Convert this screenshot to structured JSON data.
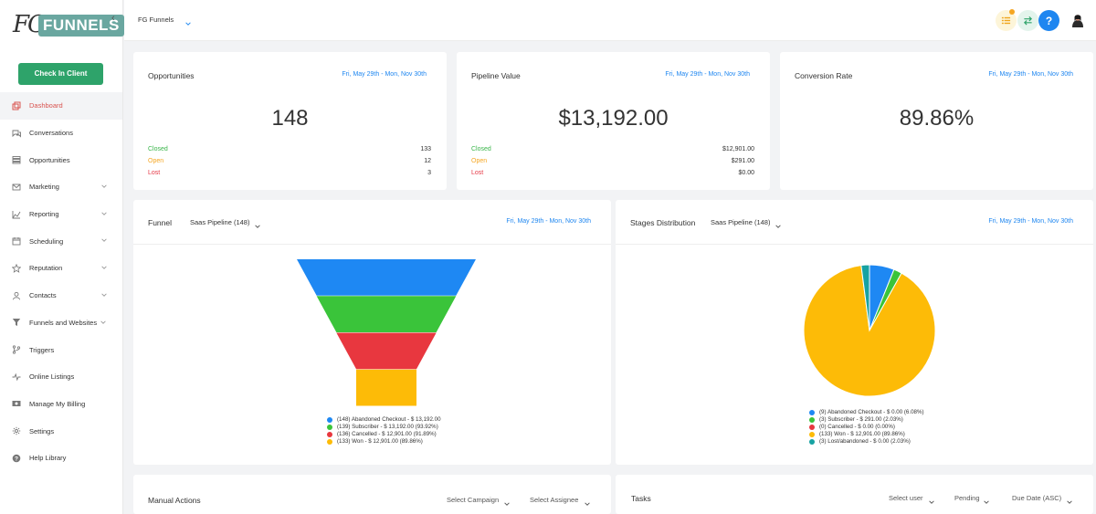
{
  "sidebar": {
    "logo_fg": "FG",
    "logo_text": "FUNNELS",
    "checkin_label": "Check In Client",
    "items": [
      {
        "label": "Dashboard",
        "icon": "dashboard-icon",
        "active": true
      },
      {
        "label": "Conversations",
        "icon": "chat-icon"
      },
      {
        "label": "Opportunities",
        "icon": "opportunities-icon"
      },
      {
        "label": "Marketing",
        "icon": "mail-icon"
      },
      {
        "label": "Reporting",
        "icon": "reporting-icon"
      },
      {
        "label": "Scheduling",
        "icon": "calendar-icon"
      },
      {
        "label": "Reputation",
        "icon": "star-icon"
      },
      {
        "label": "Contacts",
        "icon": "user-icon"
      },
      {
        "label": "Funnels and Websites",
        "icon": "filter-icon"
      },
      {
        "label": "Triggers",
        "icon": "branch-icon"
      },
      {
        "label": "Online Listings",
        "icon": "pulse-icon"
      },
      {
        "label": "Manage My Billing",
        "icon": "billing-icon"
      },
      {
        "label": "Settings",
        "icon": "gear-icon"
      },
      {
        "label": "Help Library",
        "icon": "help-icon"
      }
    ]
  },
  "topbar": {
    "account": "FG Funnels",
    "help_label": "?"
  },
  "opportunities": {
    "title": "Opportunities",
    "date": "Fri, May 29th - Mon, Nov 30th",
    "total": "148",
    "rows": [
      {
        "label": "Closed",
        "value": "133"
      },
      {
        "label": "Open",
        "value": "12"
      },
      {
        "label": "Lost",
        "value": "3"
      }
    ]
  },
  "pipeline_value": {
    "title": "Pipeline Value",
    "date": "Fri, May 29th - Mon, Nov 30th",
    "total": "$13,192.00",
    "rows": [
      {
        "label": "Closed",
        "value": "$12,901.00"
      },
      {
        "label": "Open",
        "value": "$291.00"
      },
      {
        "label": "Lost",
        "value": "$0.00"
      }
    ]
  },
  "conversion_rate": {
    "title": "Conversion Rate",
    "date": "Fri, May 29th - Mon, Nov 30th",
    "total": "89.86%"
  },
  "funnel": {
    "title": "Funnel",
    "pipeline": "Saas Pipeline (148)",
    "date": "Fri, May 29th - Mon, Nov 30th"
  },
  "stages": {
    "title": "Stages Distribution",
    "pipeline": "Saas Pipeline (148)",
    "date": "Fri, May 29th - Mon, Nov 30th"
  },
  "manual_actions": {
    "title": "Manual Actions",
    "filter1": "Select Campaign",
    "filter2": "Select Assignee"
  },
  "tasks": {
    "title": "Tasks",
    "filter1": "Select user",
    "filter2": "Pending",
    "filter3": "Due Date (ASC)"
  },
  "colors": {
    "blue": "#1e88f3",
    "green": "#3ac43a",
    "red": "#e8373f",
    "yellow": "#fdbb07",
    "teal": "#17a2a2"
  },
  "chart_data": [
    {
      "type": "funnel",
      "categories": [
        "Abandoned Checkout",
        "Subscriber",
        "Cancelled",
        "Won"
      ],
      "values": [
        148,
        139,
        136,
        133
      ],
      "legend": [
        "(148) Abandoned Checkout - $ 13,192.00",
        "(139) Subscriber - $ 13,192.00 (93.92%)",
        "(136) Cancelled - $ 12,901.00 (91.89%)",
        "(133) Won - $ 12,901.00 (89.86%)"
      ],
      "colors": [
        "#1e88f3",
        "#3ac43a",
        "#e8373f",
        "#fdbb07"
      ]
    },
    {
      "type": "pie",
      "categories": [
        "Abandoned Checkout",
        "Subscriber",
        "Cancelled",
        "Won",
        "Lost/abandoned"
      ],
      "values": [
        9,
        3,
        0,
        133,
        3
      ],
      "legend": [
        "(9) Abandoned Checkout - $ 0.00 (6.08%)",
        "(3) Subscriber - $ 291.00 (2.03%)",
        "(0) Cancelled - $ 0.00 (0.00%)",
        "(133) Won - $ 12,901.00 (89.86%)",
        "(3) Lost/abandoned - $ 0.00 (2.03%)"
      ],
      "colors": [
        "#1e88f3",
        "#3ac43a",
        "#e8373f",
        "#fdbb07",
        "#17a2a2"
      ]
    }
  ]
}
